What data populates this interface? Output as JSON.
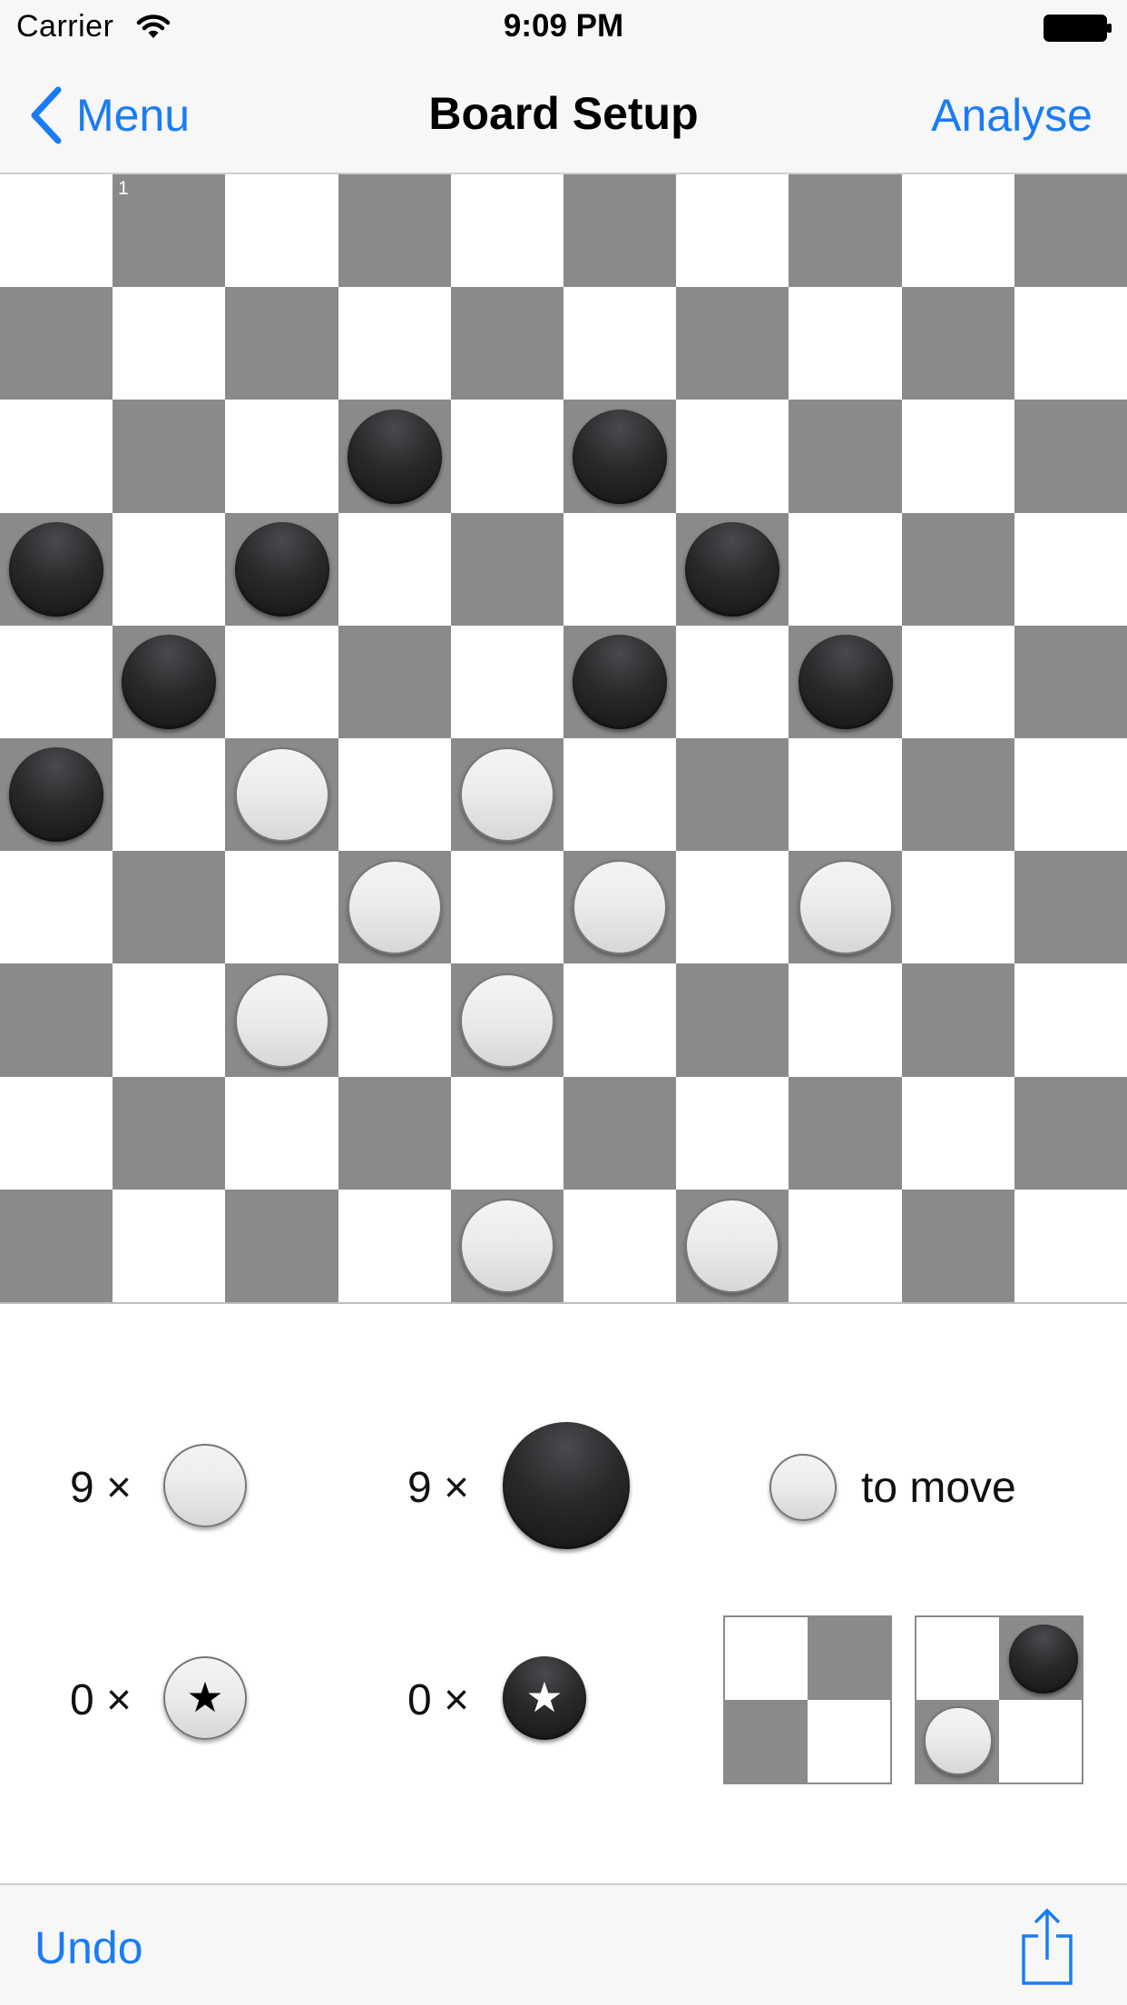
{
  "status_bar": {
    "carrier": "Carrier",
    "time": "9:09 PM",
    "wifi_icon": "wifi-icon",
    "battery_icon": "battery-full-icon"
  },
  "nav": {
    "back_label": "Menu",
    "back_icon": "chevron-left-icon",
    "title": "Board Setup",
    "action_label": "Analyse"
  },
  "board": {
    "size": 10,
    "square_number": "1",
    "colors": {
      "dark": "#8a8a8a",
      "light": "#ffffff"
    },
    "pieces": [
      {
        "row": 2,
        "col": 3,
        "color": "black"
      },
      {
        "row": 2,
        "col": 5,
        "color": "black"
      },
      {
        "row": 3,
        "col": 0,
        "color": "black"
      },
      {
        "row": 3,
        "col": 2,
        "color": "black"
      },
      {
        "row": 3,
        "col": 6,
        "color": "black"
      },
      {
        "row": 4,
        "col": 1,
        "color": "black"
      },
      {
        "row": 4,
        "col": 5,
        "color": "black"
      },
      {
        "row": 4,
        "col": 7,
        "color": "black"
      },
      {
        "row": 5,
        "col": 0,
        "color": "black"
      },
      {
        "row": 5,
        "col": 2,
        "color": "white"
      },
      {
        "row": 5,
        "col": 4,
        "color": "white"
      },
      {
        "row": 6,
        "col": 3,
        "color": "white"
      },
      {
        "row": 6,
        "col": 5,
        "color": "white"
      },
      {
        "row": 6,
        "col": 7,
        "color": "white"
      },
      {
        "row": 7,
        "col": 2,
        "color": "white"
      },
      {
        "row": 7,
        "col": 4,
        "color": "white"
      },
      {
        "row": 9,
        "col": 4,
        "color": "white"
      },
      {
        "row": 9,
        "col": 6,
        "color": "white"
      }
    ]
  },
  "palette": {
    "white_men_count": "9 ×",
    "black_men_count": "9 ×",
    "white_kings_count": "0 ×",
    "black_kings_count": "0 ×",
    "king_icon": "star-icon",
    "selected_piece": "black-man",
    "to_move_label": "to move",
    "to_move_color": "white"
  },
  "toolbar": {
    "undo_label": "Undo",
    "share_icon": "share-icon"
  },
  "accent_color": "#1a7cf5"
}
